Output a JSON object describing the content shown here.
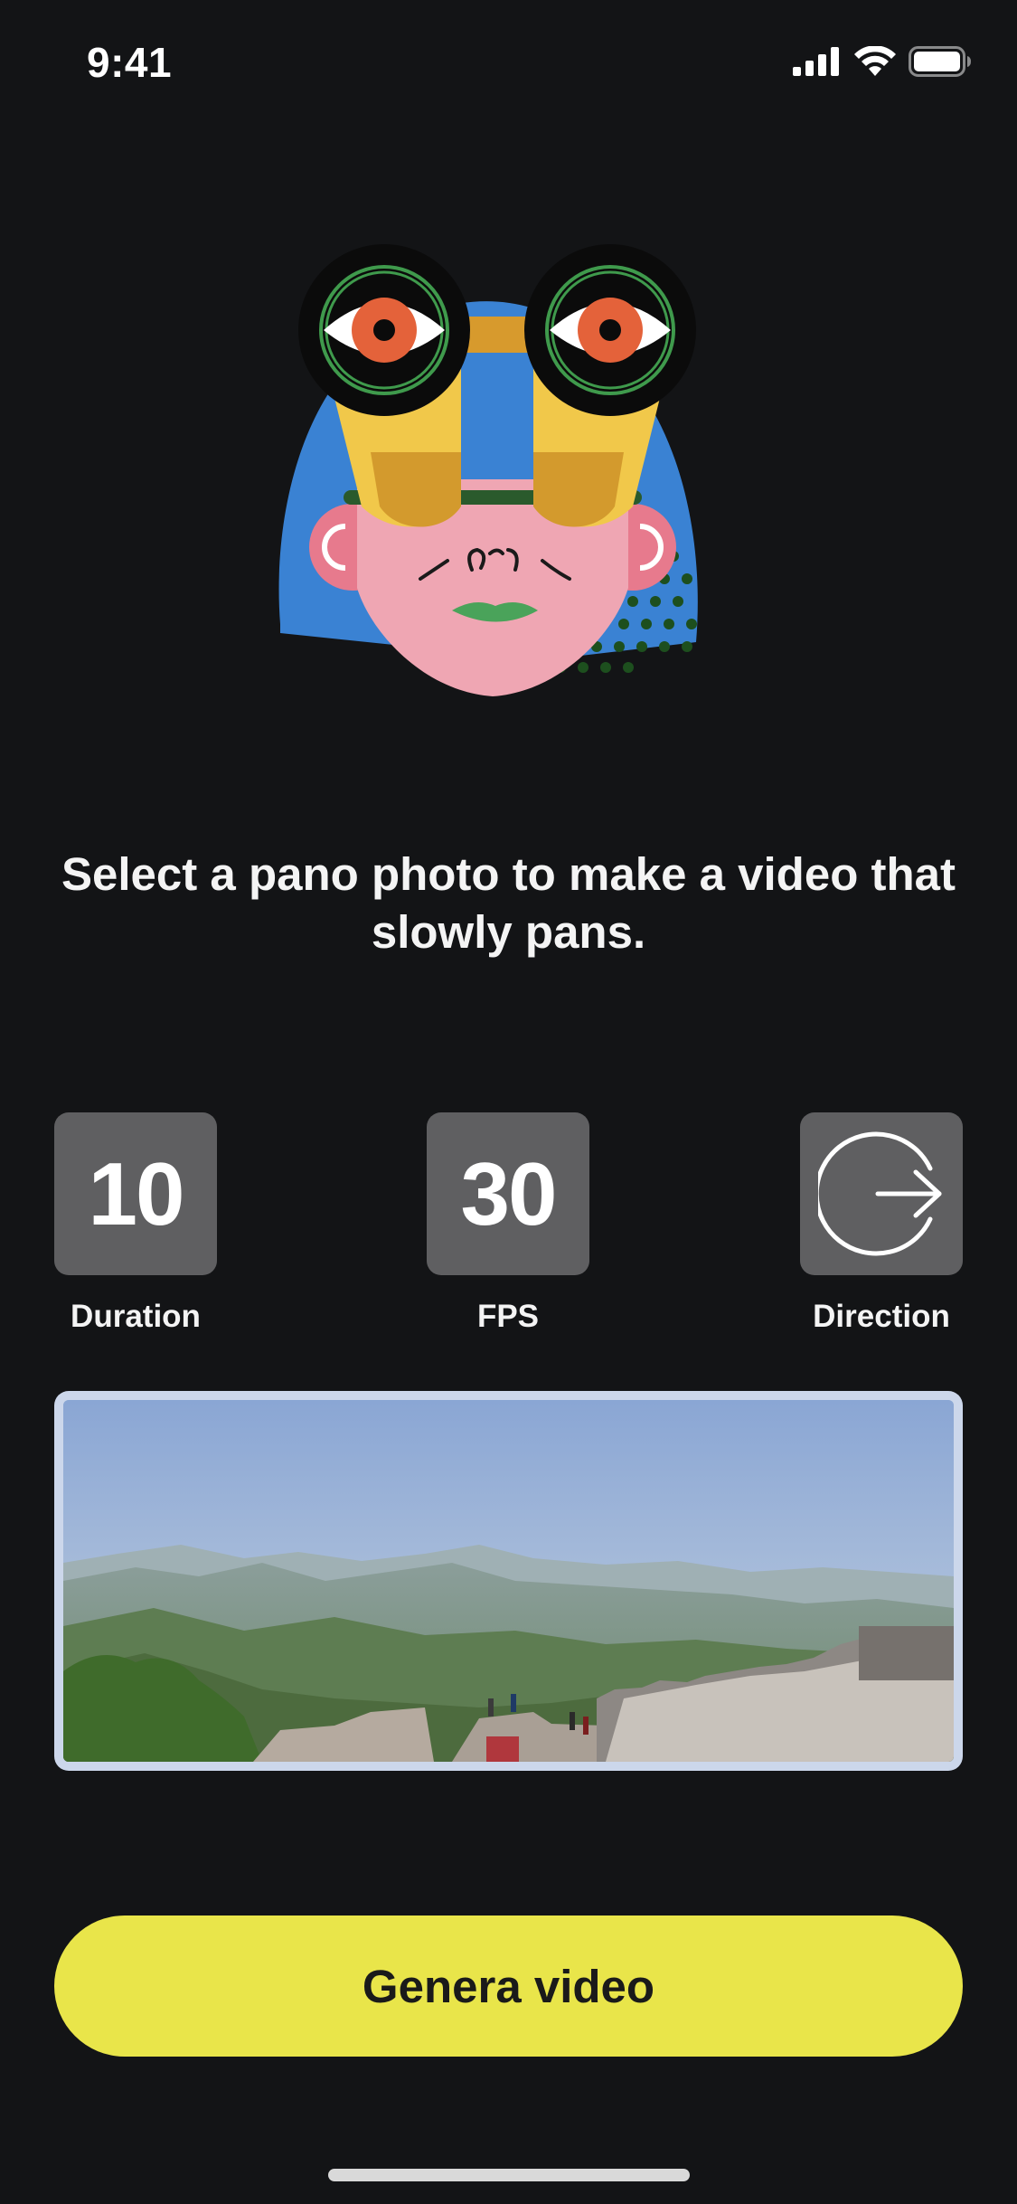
{
  "status_bar": {
    "time": "9:41"
  },
  "headline": "Select a pano photo to make a video that slowly pans.",
  "settings": {
    "duration": {
      "value": "10",
      "label": "Duration"
    },
    "fps": {
      "value": "30",
      "label": "FPS"
    },
    "direction": {
      "label": "Direction",
      "icon": "arrow-right-circle-icon"
    }
  },
  "cta": {
    "label": "Genera video"
  },
  "colors": {
    "background": "#131416",
    "tile": "#5f5f61",
    "cta": "#e9e54a"
  }
}
